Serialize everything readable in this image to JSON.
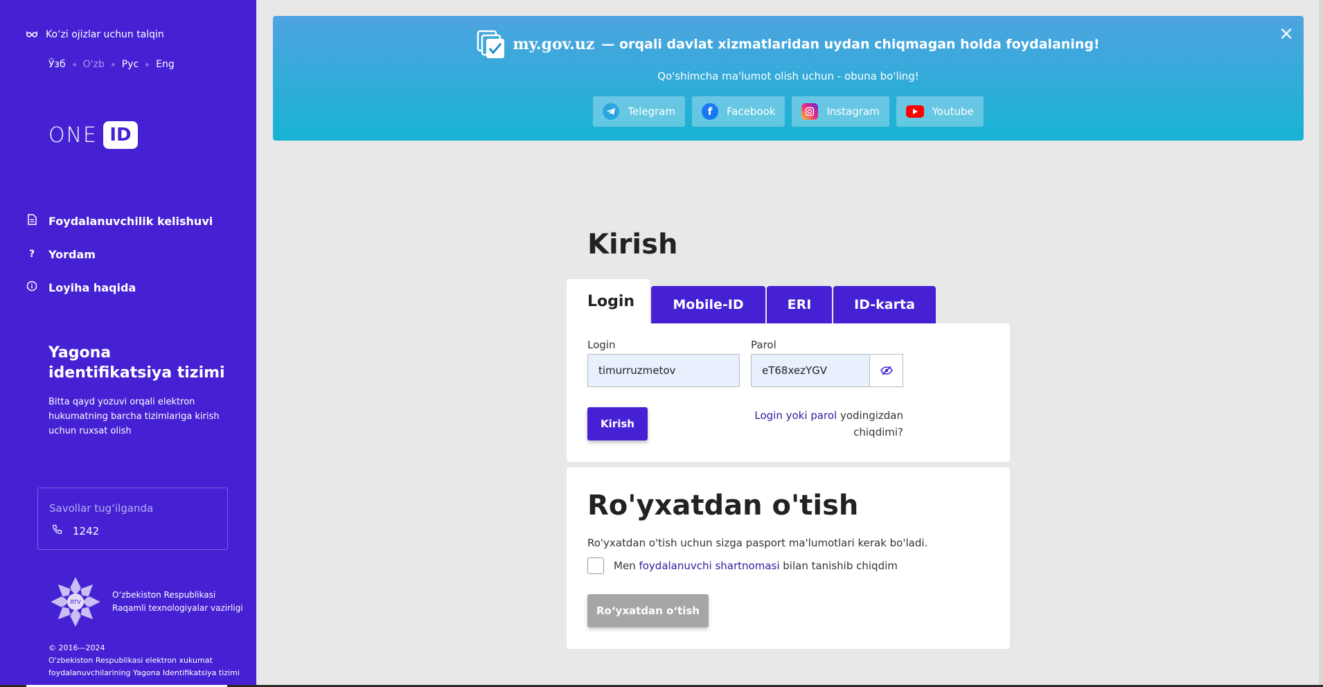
{
  "sidebar": {
    "accessibility": "Ko‘zi ojizlar uchun talqin",
    "languages": [
      "Ўзб",
      "O'zb",
      "Рус",
      "Eng"
    ],
    "logo_text": "ONE",
    "logo_badge": "ID",
    "nav": [
      {
        "label": "Foydalanuvchilik kelishuvi",
        "icon": "document-icon"
      },
      {
        "label": "Yordam",
        "icon": "question-icon"
      },
      {
        "label": "Loyiha haqida",
        "icon": "info-icon"
      }
    ],
    "project_title": "Yagona identifikatsiya tizimi",
    "project_desc": "Bitta qayd yozuvi orqali elektron hukumatning barcha tizimlariga kirish uchun ruxsat olish",
    "contact_label": "Savollar tug‘ilganda",
    "phone": "1242",
    "ministry": "O‘zbekiston Respublikasi Raqamli texnologiyalar vazirligi",
    "emblem_text": "RTV",
    "copyright_years": "© 2016—2024",
    "copyright_text": "O'zbekiston Respublikasi elektron xukumat foydalanuvchilarining Yagona Identifikatsiya tizimi"
  },
  "banner": {
    "site": "my.gov.uz",
    "slogan": "— orqali davlat xizmatlaridan uydan chiqmagan holda foydalaning!",
    "subtitle": "Qo'shimcha ma'lumot olish uchun - obuna bo'ling!",
    "socials": [
      {
        "label": "Telegram",
        "color": "#2ca5e0"
      },
      {
        "label": "Facebook",
        "color": "#1877f2"
      },
      {
        "label": "Instagram",
        "color": "#d6249f"
      },
      {
        "label": "Youtube",
        "color": "#ff0000"
      }
    ]
  },
  "main": {
    "title": "Kirish",
    "tabs": [
      "Login",
      "Mobile-ID",
      "ERI",
      "ID-karta"
    ],
    "login_label": "Login",
    "login_value": "timurruzmetov",
    "password_label": "Parol",
    "password_value": "eT68xezYGV",
    "submit": "Kirish",
    "forgot_link": "Login yoki parol",
    "forgot_rest": "yodingizdan chiqdimi?"
  },
  "register": {
    "title": "Ro'yxatdan o'tish",
    "desc": "Ro'yxatdan o'tish uchun sizga pasport ma'lumotlari kerak bo'ladi.",
    "agree_prefix": "Men",
    "agree_link": "foydalanuvchi shartnomasi",
    "agree_suffix": "bilan tanishib chiqdim",
    "button": "Ro‘yxatdan o‘tish"
  },
  "colors": {
    "primary": "#4521d3",
    "disabled": "#a6a6a6"
  }
}
